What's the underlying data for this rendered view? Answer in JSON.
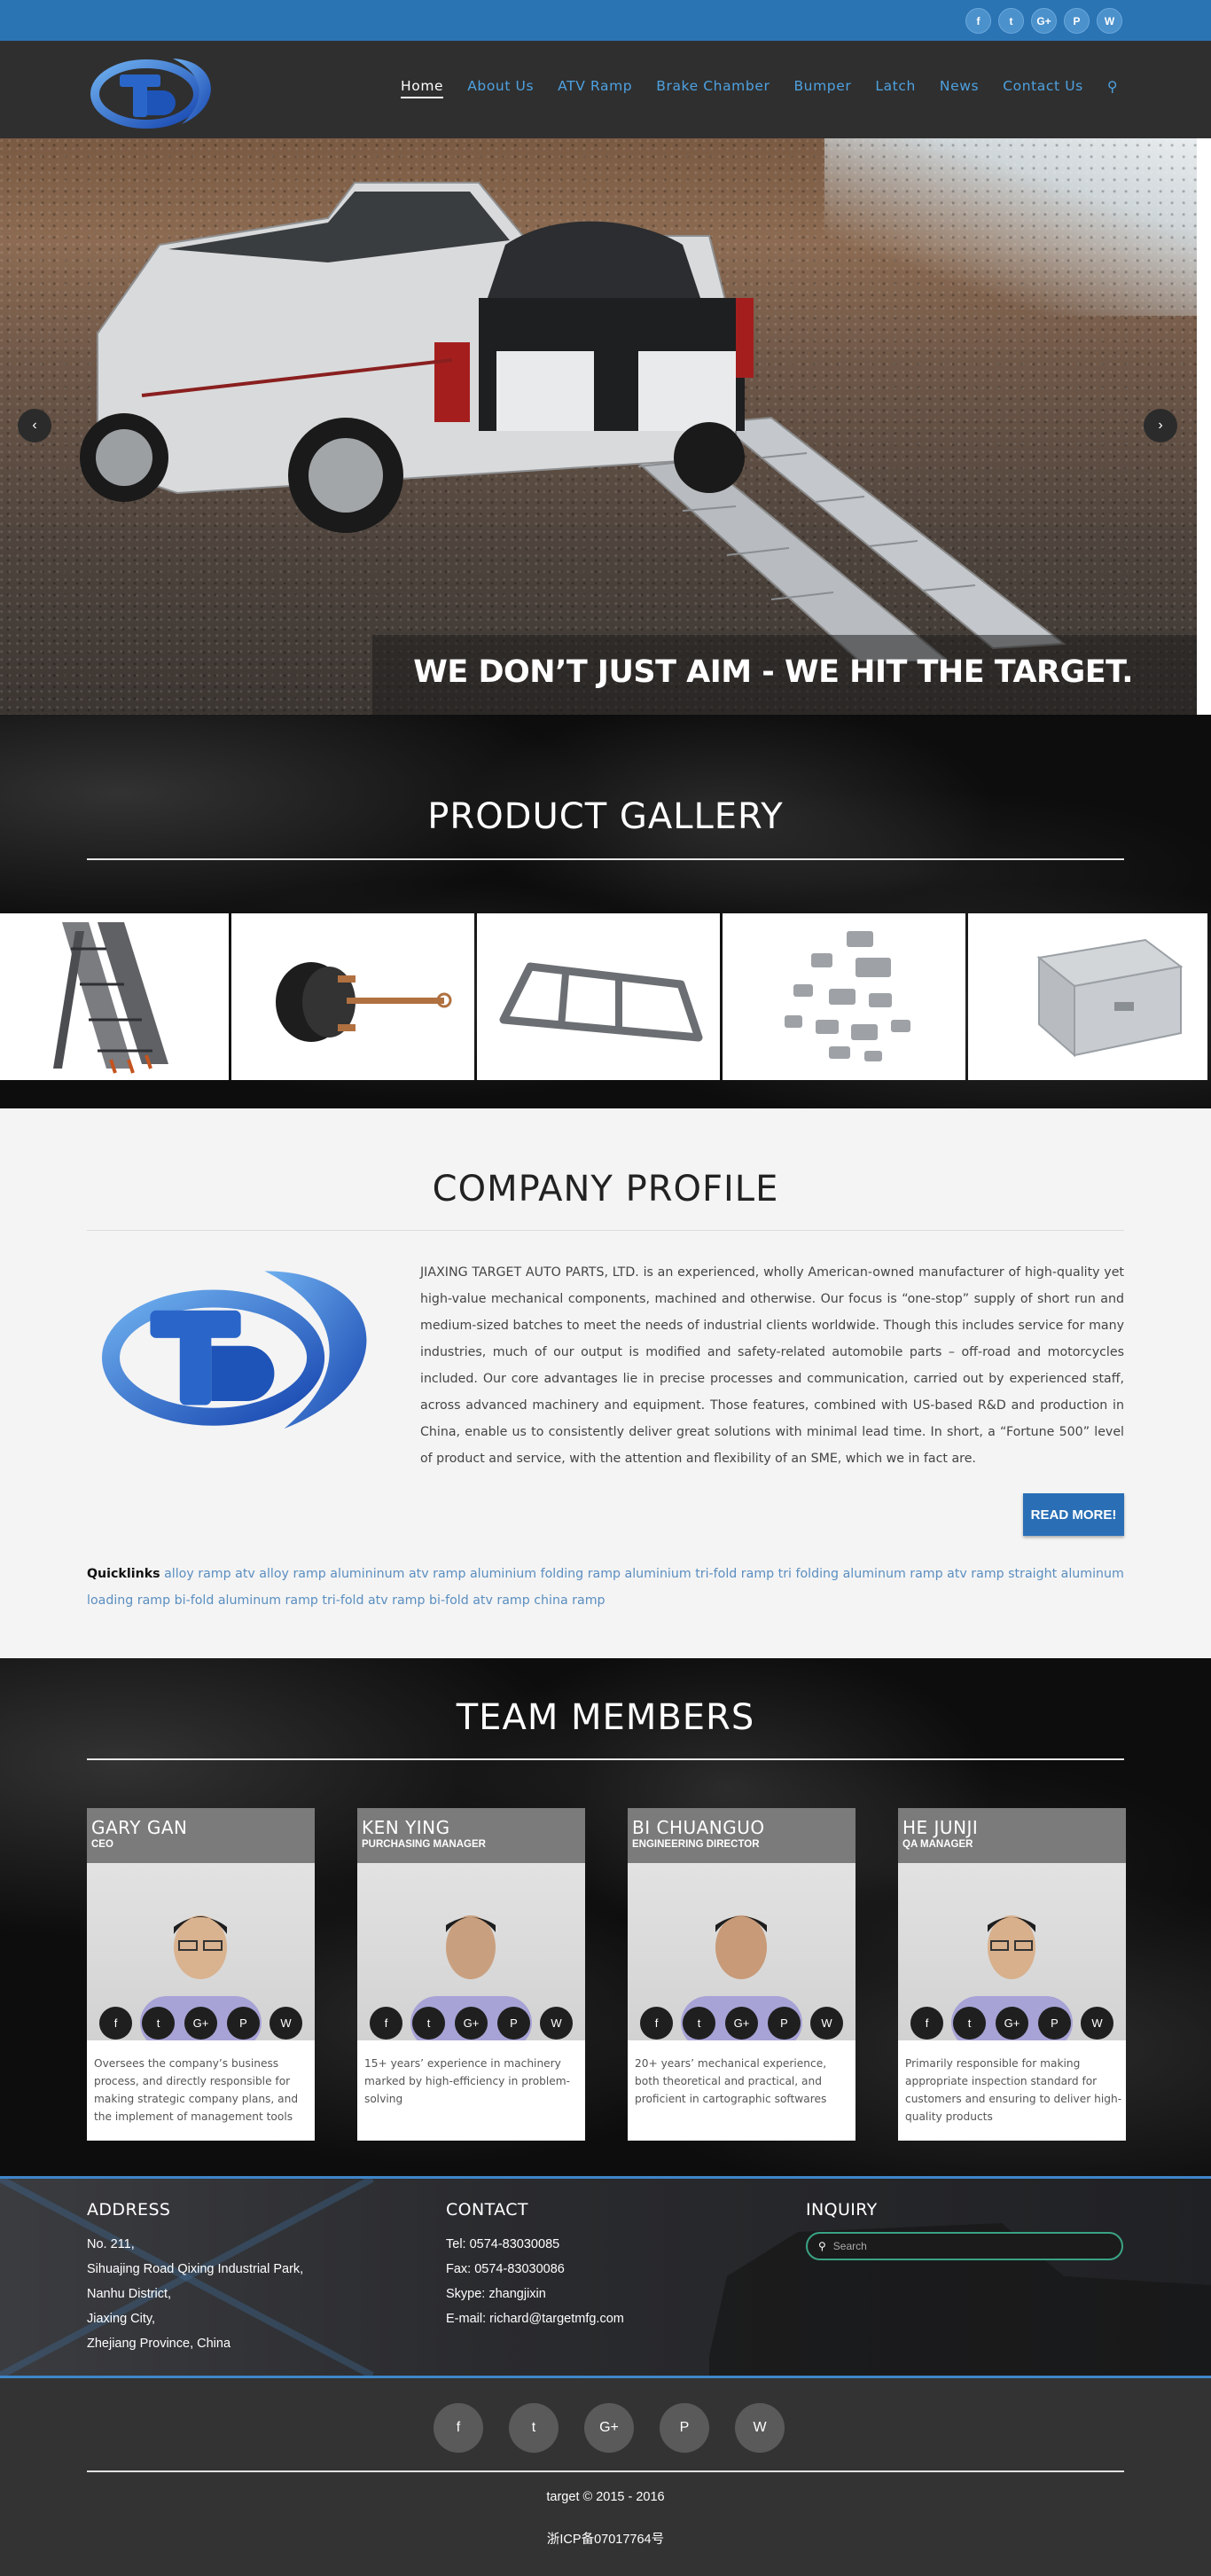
{
  "top_social": [
    "f",
    "t",
    "G+",
    "P",
    "W"
  ],
  "nav": {
    "items": [
      "Home",
      "About Us",
      "ATV Ramp",
      "Brake Chamber",
      "Bumper",
      "Latch",
      "News",
      "Contact Us"
    ],
    "search_icon": "search-icon"
  },
  "hero": {
    "caption": "WE DON’T JUST AIM - WE HIT THE TARGET.",
    "prev": "‹",
    "next": "›"
  },
  "gallery": {
    "title": "PRODUCT GALLERY",
    "products": [
      "atv-ramp",
      "brake-chamber",
      "bumper",
      "latch",
      "tool-box"
    ]
  },
  "profile": {
    "title": "COMPANY PROFILE",
    "text": " JIAXING TARGET AUTO PARTS, LTD. is an experienced, wholly American-owned manufacturer of high-quality yet high-value mechanical components, machined and otherwise. Our focus is “one-stop” supply of short run and medium-sized batches to meet the needs of industrial clients worldwide. Though this includes service for many industries, much of our output is modified and safety-related automobile parts – off-road and motorcycles included. Our core advantages lie in precise processes and communication, carried out by experienced staff, across advanced machinery and equipment. Those features, combined with US-based R&D and production in China, enable us to consistently deliver great solutions with minimal lead time. In short, a “Fortune 500” level of product and service, with the attention and flexibility of an SME, which we in fact are.",
    "read_more": "READ MORE!",
    "quicklinks_label": "Quicklinks",
    "quicklinks": "alloy ramp atv alloy ramp alumininum atv ramp aluminium folding ramp aluminium tri-fold ramp tri folding aluminum ramp atv ramp straight aluminum loading ramp bi-fold aluminum ramp tri-fold atv ramp bi-fold atv ramp china ramp"
  },
  "team": {
    "title": "TEAM MEMBERS",
    "members": [
      {
        "name": "GARY GAN",
        "role": "CEO",
        "desc": "Oversees the company’s business process, and directly responsible for making strategic company plans, and the implement of management tools"
      },
      {
        "name": "KEN YING",
        "role": "PURCHASING MANAGER",
        "desc": "15+ years’ experience in machinery marked by high-efficiency in problem-solving"
      },
      {
        "name": "BI CHUANGUO",
        "role": "ENGINEERING DIRECTOR",
        "desc": "20+ years’ mechanical experience, both theoretical and practical, and proficient in cartographic softwares"
      },
      {
        "name": "HE JUNJI",
        "role": "QA MANAGER",
        "desc": "Primarily responsible for making appropriate inspection standard for customers and ensuring to deliver high-quality products"
      }
    ],
    "member_social": [
      "f",
      "t",
      "G+",
      "P",
      "W"
    ]
  },
  "footer": {
    "address_title": "ADDRESS",
    "address_lines": [
      "No. 211,",
      "Sihuajing Road Qixing Industrial Park,",
      "Nanhu District,",
      "Jiaxing City,",
      "Zhejiang Province, China"
    ],
    "contact_title": "CONTACT",
    "contact_lines": [
      "Tel: 0574-83030085",
      "Fax: 0574-83030086",
      "Skype: zhangjixin",
      "E-mail: richard@targetmfg.com"
    ],
    "inquiry_title": "INQUIRY",
    "search_placeholder": "Search",
    "copyright": "target © 2015 - 2016",
    "icp": "浙ICP备07017764号"
  },
  "colors": {
    "topbar": "#2a74b4",
    "header": "#2f2f2f",
    "nav_link": "#4ea1e0",
    "button": "#2a6fb6",
    "footer_border": "#3f86c9",
    "bottom": "#333333"
  }
}
